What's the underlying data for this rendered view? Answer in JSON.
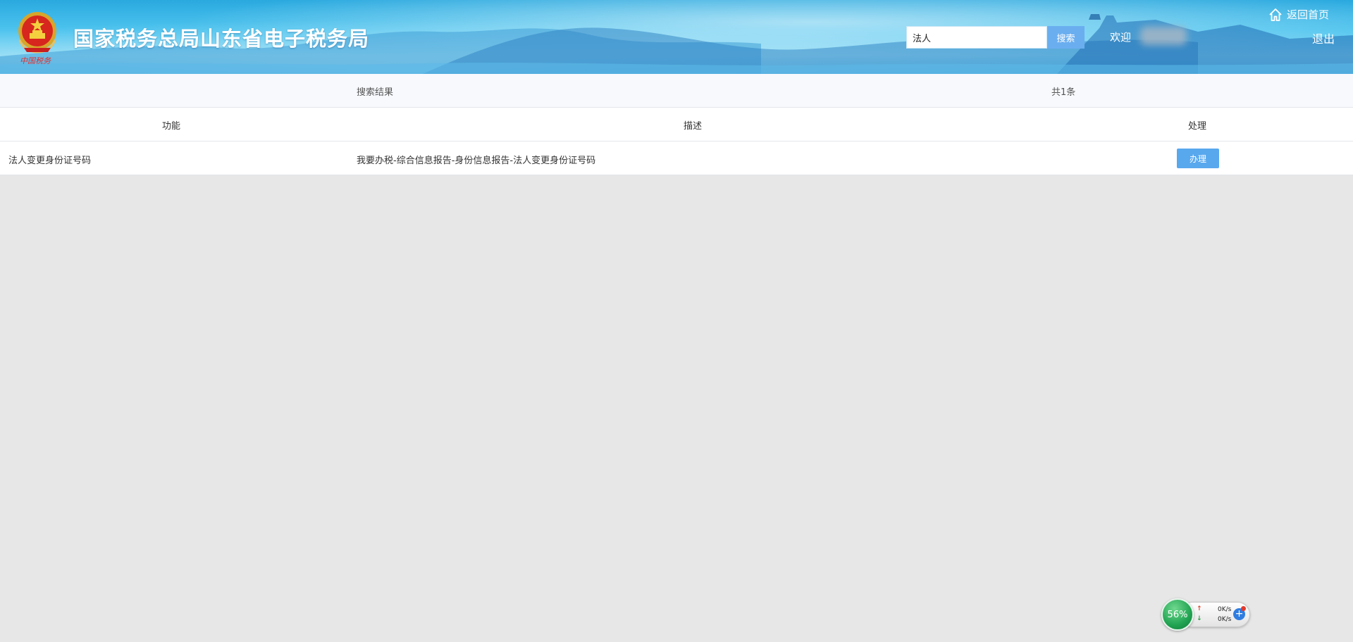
{
  "header": {
    "title": "国家税务总局山东省电子税务局",
    "search": {
      "value": "法人",
      "button_label": "搜索"
    },
    "welcome_label": "欢迎",
    "home_label": "返回首页",
    "logout_label": "退出",
    "emblem_caption": "中国税务"
  },
  "results": {
    "summary_label": "搜索结果",
    "count_label": "共1条",
    "columns": [
      "功能",
      "描述",
      "处理"
    ],
    "rows": [
      {
        "function": "法人变更身份证号码",
        "description": "我要办税-综合信息报告-身份信息报告-法人变更身份证号码",
        "action_label": "办理"
      }
    ]
  },
  "widget": {
    "percent_label": "56%",
    "upload_speed": "0K/s",
    "download_speed": "0K/s",
    "upload_arrow": "↑",
    "download_arrow": "↓"
  },
  "colors": {
    "header_blue": "#2aa9df",
    "button_blue": "#58a8ee",
    "page_background": "#e7e7e7"
  },
  "icons": {
    "home": "home-icon",
    "plus": "plus-icon"
  }
}
